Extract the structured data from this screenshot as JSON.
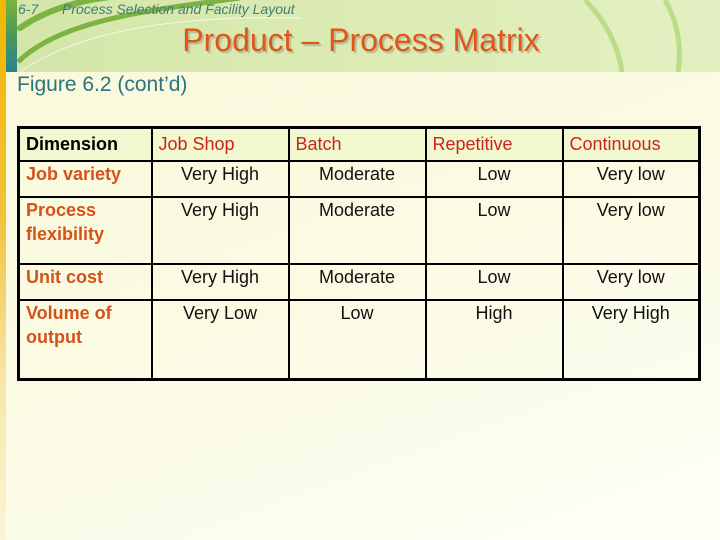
{
  "header": {
    "slide_number": "6-7",
    "course_title": "Process Selection and Facility Layout",
    "title": "Product – Process Matrix"
  },
  "figure_label": "Figure 6.2 (cont’d)",
  "colors": {
    "title": "#e0561a",
    "header_text": "#3f7d7a",
    "figure_label": "#2c7480",
    "column_header": "#cc2418",
    "row_label": "#d4521a",
    "header_row_bg": "#f1f8d0"
  },
  "table": {
    "columns": [
      "Dimension",
      "Job Shop",
      "Batch",
      "Repetitive",
      "Continuous"
    ],
    "rows": [
      {
        "label": "Job variety",
        "values": [
          "Very High",
          "Moderate",
          "Low",
          "Very low"
        ]
      },
      {
        "label": "Process flexibility",
        "values": [
          "Very High",
          "Moderate",
          "Low",
          "Very low"
        ]
      },
      {
        "label": "Unit cost",
        "values": [
          "Very High",
          "Moderate",
          "Low",
          "Very low"
        ]
      },
      {
        "label": "Volume of output",
        "values": [
          "Very Low",
          "Low",
          "High",
          "Very High"
        ]
      }
    ]
  }
}
